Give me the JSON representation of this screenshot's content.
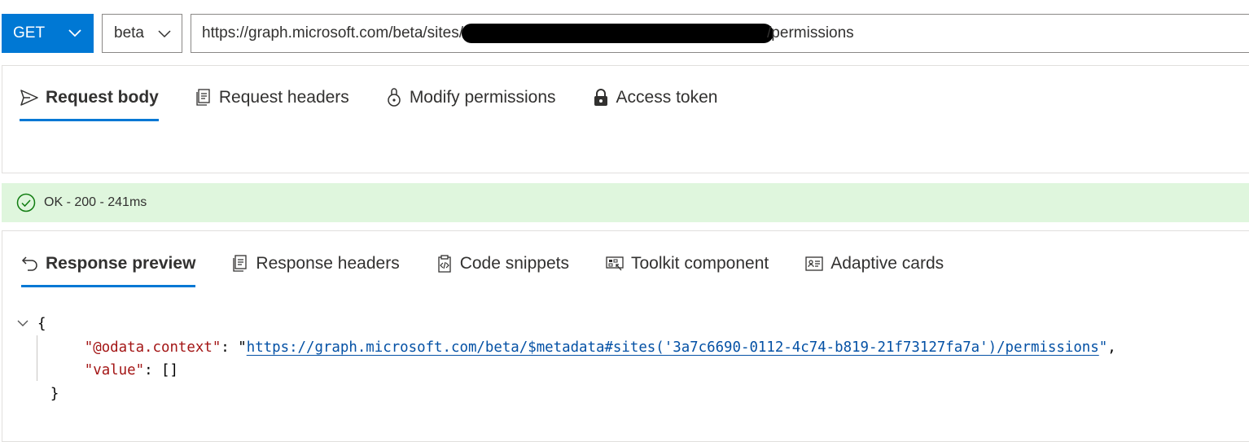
{
  "request": {
    "method": "GET",
    "version": "beta",
    "url_prefix": "https://graph.microsoft.com/beta/sites/",
    "url_suffix": "/permissions"
  },
  "request_tabs": [
    {
      "label": "Request body",
      "icon": "send-icon",
      "active": true
    },
    {
      "label": "Request headers",
      "icon": "headers-icon",
      "active": false
    },
    {
      "label": "Modify permissions",
      "icon": "permissions-icon",
      "active": false
    },
    {
      "label": "Access token",
      "icon": "lock-icon",
      "active": false
    }
  ],
  "status": {
    "text": "OK - 200 - 241ms",
    "color": "#dff6dd"
  },
  "response_tabs": [
    {
      "label": "Response preview",
      "icon": "undo-arrow-icon",
      "active": true
    },
    {
      "label": "Response headers",
      "icon": "headers-icon",
      "active": false
    },
    {
      "label": "Code snippets",
      "icon": "code-clipboard-icon",
      "active": false
    },
    {
      "label": "Toolkit component",
      "icon": "toolkit-icon",
      "active": false
    },
    {
      "label": "Adaptive cards",
      "icon": "card-icon",
      "active": false
    }
  ],
  "response": {
    "open_brace": "{",
    "close_brace": "}",
    "context_key": "\"@odata.context\"",
    "context_value": "https://graph.microsoft.com/beta/$metadata#sites('3a7c6690-0112-4c74-b819-21f73127fa7a')/permissions",
    "value_key": "\"value\"",
    "value_value": "[]"
  },
  "colors": {
    "accent": "#0078d4",
    "json_key": "#a31515",
    "json_string": "#0451a5"
  }
}
